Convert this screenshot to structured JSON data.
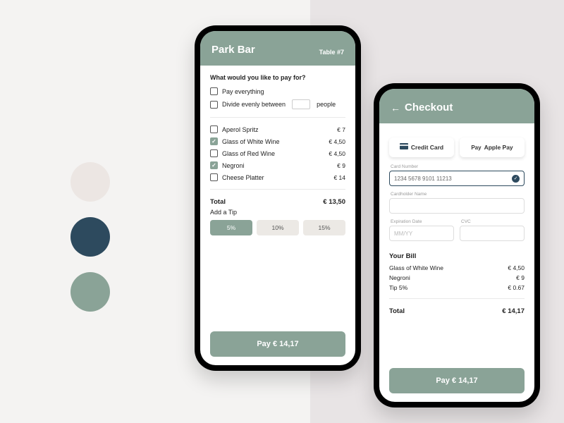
{
  "palette": {
    "cream": "#ece6e3",
    "navy": "#2d4a5e",
    "sage": "#8aa397"
  },
  "screen1": {
    "title": "Park Bar",
    "table": "Table #7",
    "prompt": "What would you like to pay for?",
    "opt_all": "Pay everything",
    "opt_split_a": "Divide evenly between",
    "opt_split_b": "people",
    "items": [
      {
        "name": "Aperol Spritz",
        "price": "€ 7",
        "checked": false
      },
      {
        "name": "Glass of White Wine",
        "price": "€ 4,50",
        "checked": true
      },
      {
        "name": "Glass of Red Wine",
        "price": "€ 4,50",
        "checked": false
      },
      {
        "name": "Negroni",
        "price": "€ 9",
        "checked": true
      },
      {
        "name": "Cheese Platter",
        "price": "€ 14",
        "checked": false
      }
    ],
    "total_label": "Total",
    "total_value": "€ 13,50",
    "tip_label": "Add a Tip",
    "tips": [
      "5%",
      "10%",
      "15%"
    ],
    "tip_selected": 0,
    "pay": "Pay € 14,17"
  },
  "screen2": {
    "title": "Checkout",
    "tabs": {
      "cc": "Credit Card",
      "ap": "Apple Pay",
      "ap_prefix": "Pay"
    },
    "card_number_label": "Card Number",
    "card_number": "1234 5678 9101 11213",
    "name_label": "Cardholder Name",
    "exp_label": "Expiration Date",
    "exp_ph": "MM/YY",
    "cvc_label": "CVC",
    "bill_title": "Your Bill",
    "bill": [
      {
        "name": "Glass of White Wine",
        "price": "€ 4,50"
      },
      {
        "name": "Negroni",
        "price": "€ 9"
      },
      {
        "name": "Tip 5%",
        "price": "€ 0.67"
      }
    ],
    "total_label": "Total",
    "total_value": "€ 14,17",
    "pay": "Pay € 14,17"
  }
}
